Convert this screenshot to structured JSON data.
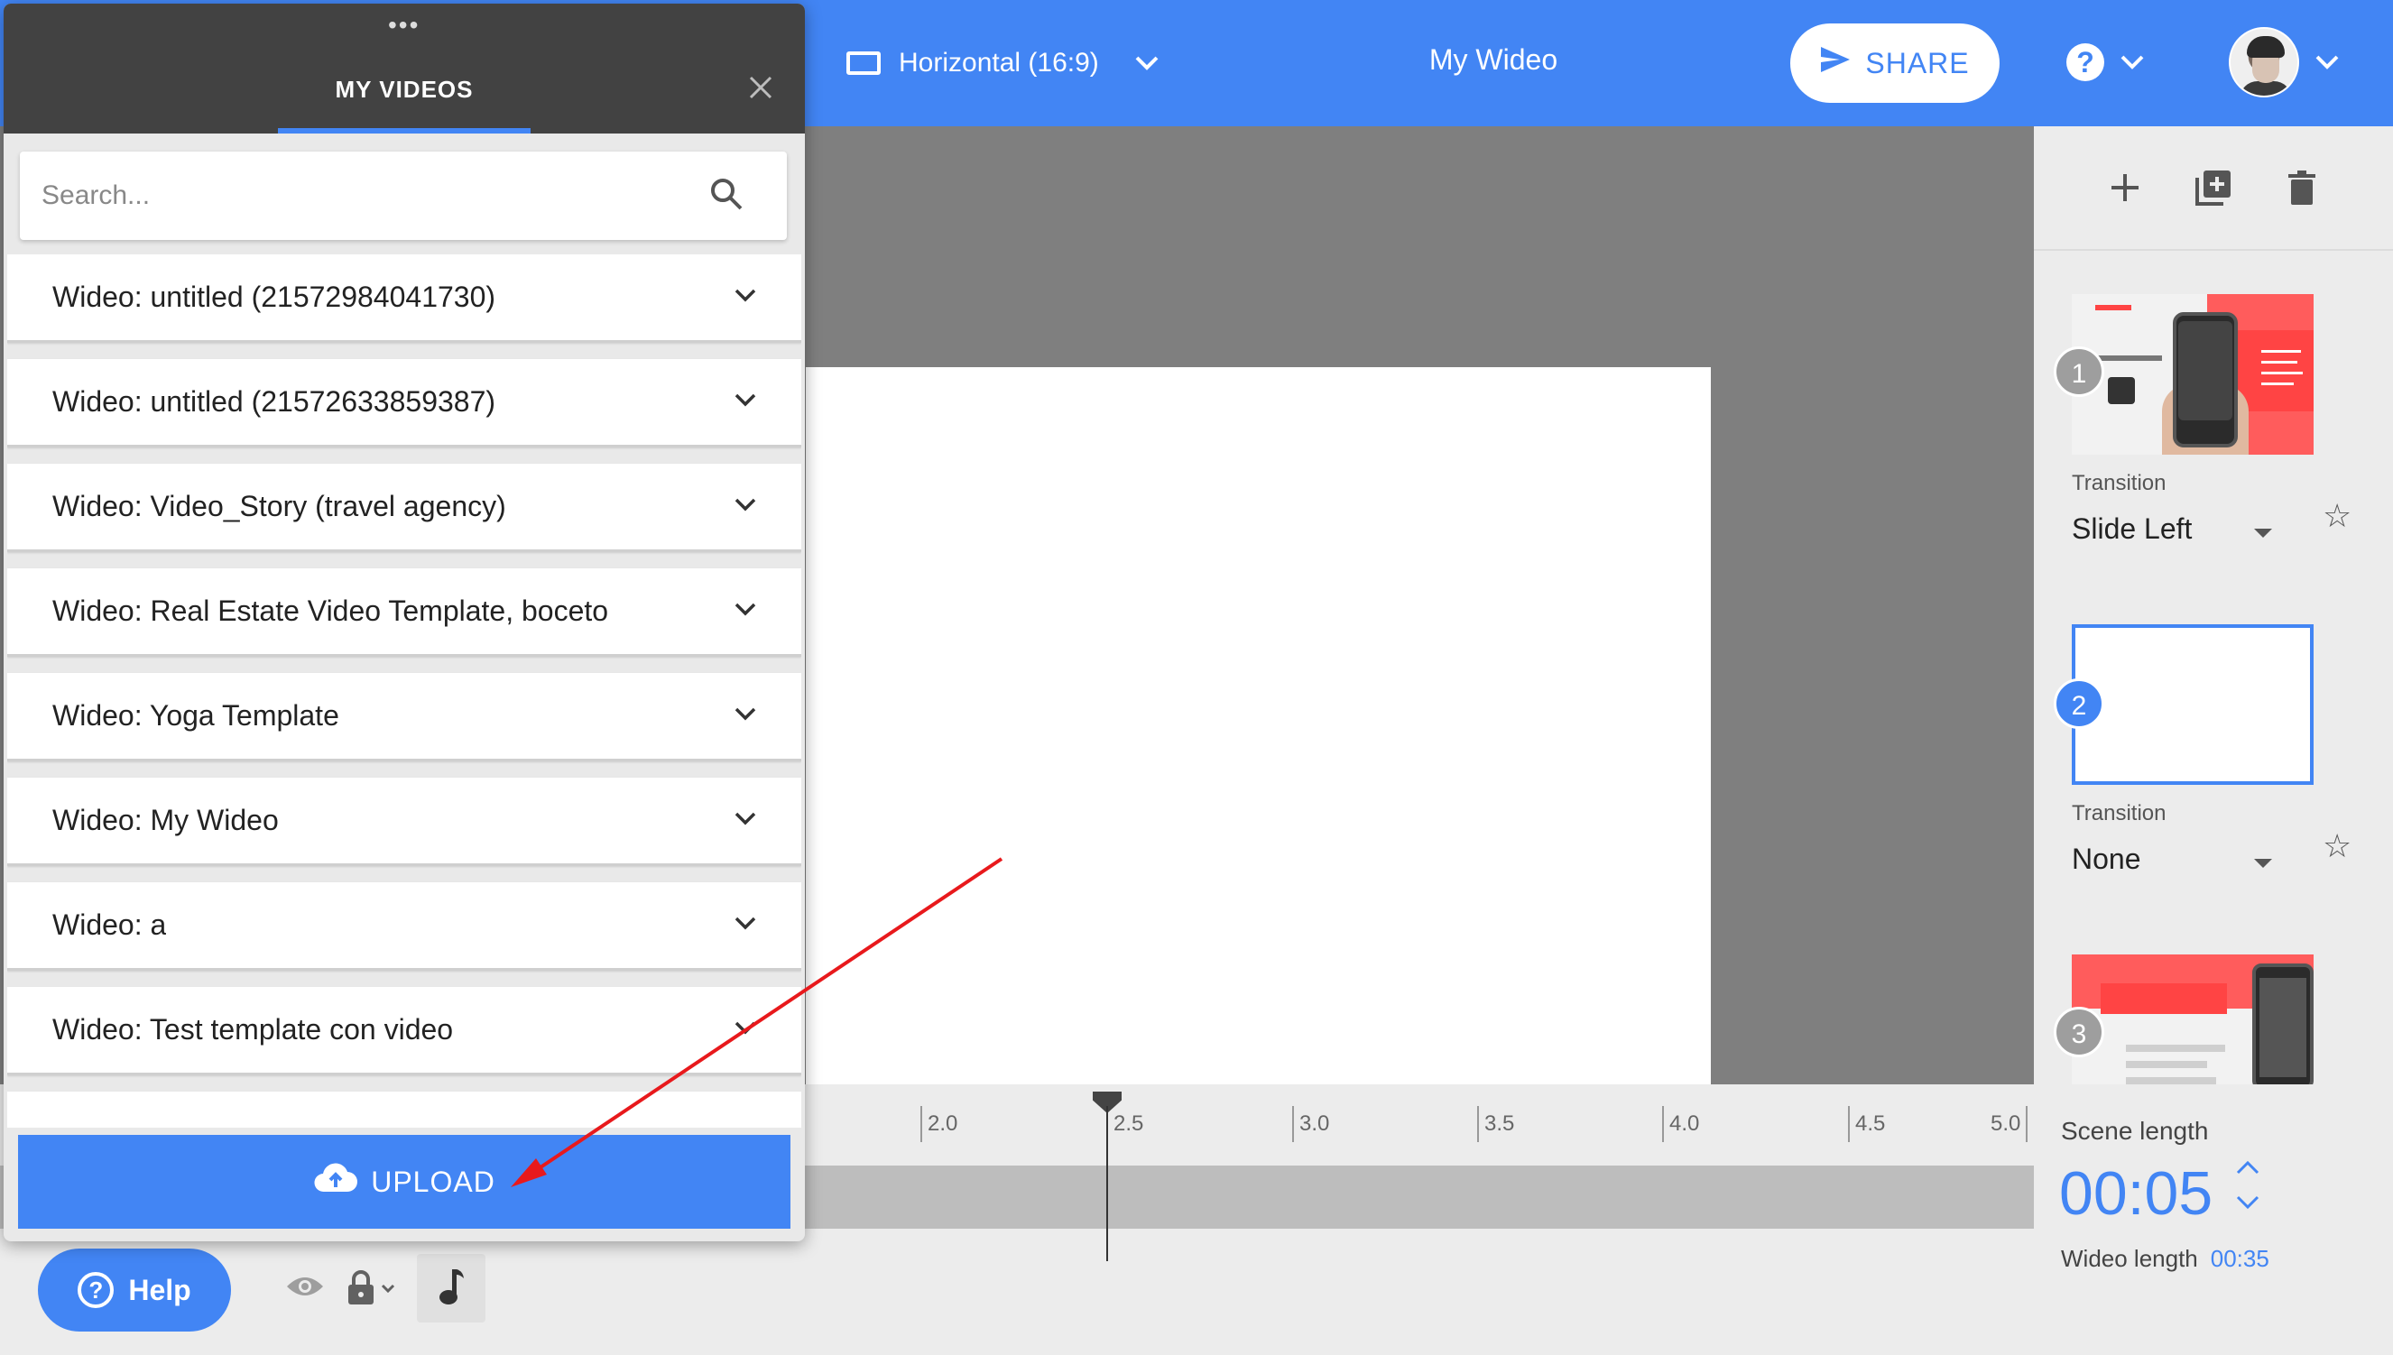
{
  "header": {
    "format_label": "Horizontal (16:9)",
    "video_title": "My Wideo",
    "share_label": "SHARE",
    "help_glyph": "?",
    "accent_color": "#4285f4"
  },
  "videos_panel": {
    "title": "MY VIDEOS",
    "drag_handle": "•••",
    "search_placeholder": "Search...",
    "items": [
      {
        "label": "Wideo: untitled (21572984041730)"
      },
      {
        "label": "Wideo: untitled (21572633859387)"
      },
      {
        "label": "Wideo: Video_Story (travel agency)"
      },
      {
        "label": "Wideo: Real Estate Video Template, boceto"
      },
      {
        "label": "Wideo: Yoga Template"
      },
      {
        "label": "Wideo: My Wideo"
      },
      {
        "label": "Wideo: a"
      },
      {
        "label": "Wideo: Test template con video"
      }
    ],
    "upload_label": "UPLOAD"
  },
  "scenes": [
    {
      "number": "1",
      "transition_label": "Transition",
      "transition_value": "Slide Left"
    },
    {
      "number": "2",
      "transition_label": "Transition",
      "transition_value": "None"
    },
    {
      "number": "3"
    }
  ],
  "timeline": {
    "ticks": [
      "2.0",
      "2.5",
      "3.0",
      "3.5",
      "4.0",
      "4.5",
      "5.0"
    ]
  },
  "scene_length": {
    "label": "Scene length",
    "value": "00:05",
    "wideo_length_label": "Wideo length",
    "wideo_length_value": "00:35"
  },
  "help_button": {
    "label": "Help",
    "glyph": "?"
  },
  "icons": {
    "top": [
      "screen-icon",
      "chevron-down-icon",
      "send-icon",
      "help-icon",
      "avatar"
    ],
    "right_toolbar": [
      "plus-icon",
      "duplicate-icon",
      "trash-icon"
    ],
    "bottom": [
      "eye-icon",
      "lock-icon",
      "music-note-icon"
    ]
  }
}
